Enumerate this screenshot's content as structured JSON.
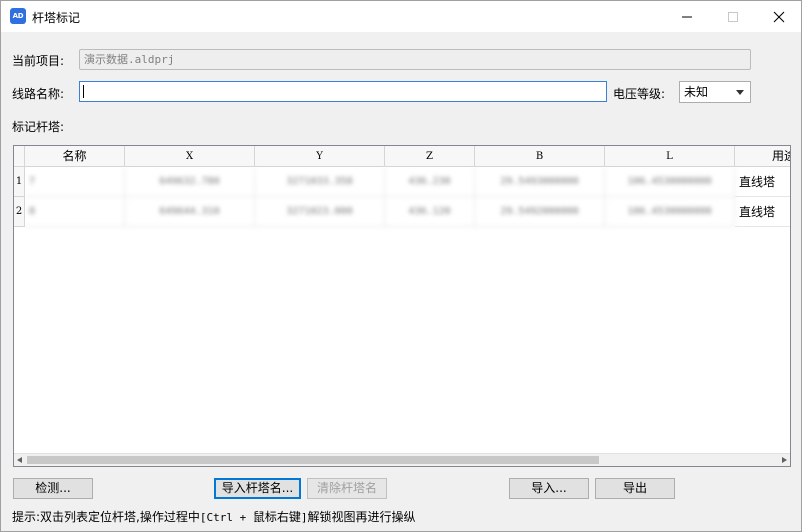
{
  "window": {
    "title": "杆塔标记",
    "icon_text": "AD",
    "accent": "#2f6fe0"
  },
  "form": {
    "project_label": "当前项目:",
    "project_value": "演示数据.aldprj",
    "route_label": "线路名称:",
    "route_value": "",
    "voltage_label": "电压等级:",
    "voltage_value": "未知",
    "mark_label": "标记杆塔:"
  },
  "table": {
    "columns": [
      "名称",
      "X",
      "Y",
      "Z",
      "B",
      "L",
      "用途"
    ],
    "rows": [
      {
        "num": "1",
        "name": "7",
        "x": "649632.780",
        "y": "3271033.358",
        "z": "436.230",
        "b": "29.5493000000",
        "l": "106.4530000000",
        "usage": "直线塔"
      },
      {
        "num": "2",
        "name": "8",
        "x": "649644.310",
        "y": "3271023.000",
        "z": "436.120",
        "b": "29.5492000000",
        "l": "106.4530000000",
        "usage": "直线塔"
      }
    ]
  },
  "buttons": {
    "detect": "检测...",
    "import_names": "导入杆塔名...",
    "clear_names": "清除杆塔名",
    "import": "导入...",
    "export": "导出"
  },
  "hint": {
    "prefix": "提示:双击列表定位杆塔,操作过程中",
    "keys": "[Ctrl + ",
    "mouse": "鼠标右键",
    "suffix": "]解锁视图再进行操纵"
  }
}
